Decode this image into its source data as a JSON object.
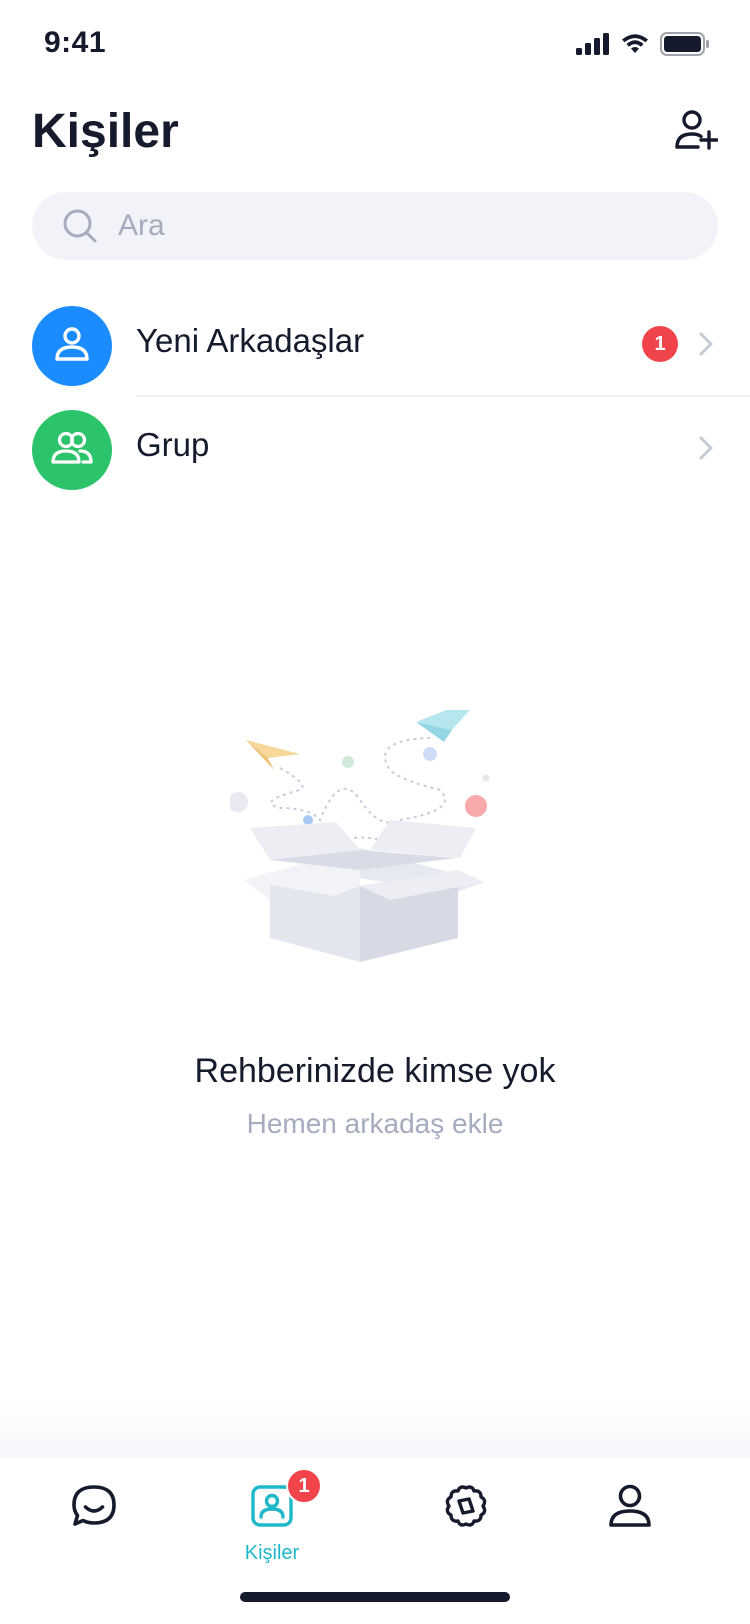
{
  "status_bar": {
    "time": "9:41"
  },
  "header": {
    "title": "Kişiler",
    "add_icon": "person-add-icon"
  },
  "search": {
    "placeholder": "Ara",
    "value": ""
  },
  "list": {
    "items": [
      {
        "label": "Yeni Arkadaşlar",
        "icon": "person-icon",
        "color": "#1a8cff",
        "badge": "1"
      },
      {
        "label": "Grup",
        "icon": "group-icon",
        "color": "#2cc46b",
        "badge": ""
      }
    ]
  },
  "empty_state": {
    "title": "Rehberinizde kimse yok",
    "subtitle": "Hemen arkadaş ekle",
    "illustration": "open-box-with-paper-planes"
  },
  "tab_bar": {
    "active_color": "#1fb8c9",
    "tabs": [
      {
        "icon": "chat-icon",
        "label": ""
      },
      {
        "icon": "contacts-icon",
        "label": "Kişiler",
        "badge": "1",
        "active": true
      },
      {
        "icon": "discover-icon",
        "label": ""
      },
      {
        "icon": "profile-icon",
        "label": ""
      }
    ]
  },
  "colors": {
    "badge": "#f0434a",
    "text": "#151a2d",
    "muted": "#a6abc0",
    "search_bg": "#f2f3f8"
  }
}
